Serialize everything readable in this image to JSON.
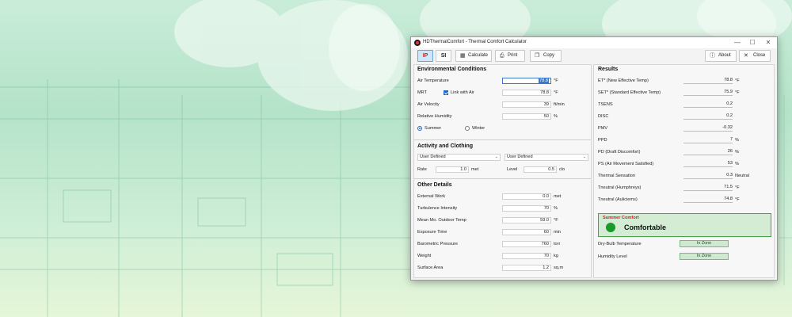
{
  "window": {
    "title": "HDThermalComfort - Thermal Comfort Calculator",
    "controls": [
      "—",
      "☐",
      "✕"
    ]
  },
  "toolbar": {
    "ip_label": "IP",
    "si_label": "SI",
    "calculate_label": "Calculate",
    "print_label": "Print",
    "copy_label": "Copy",
    "about_label": "About",
    "close_label": "Close",
    "active_unit": "IP"
  },
  "environmental": {
    "title": "Environmental Conditions",
    "air_temp": {
      "label": "Air Temperature",
      "value": "78.8",
      "unit": "°F"
    },
    "mrt": {
      "label": "MRT",
      "link_label": "Link with Air",
      "linked": true,
      "value": "78.8",
      "unit": "°F"
    },
    "air_velocity": {
      "label": "Air Velocity",
      "value": "39",
      "unit": "ft/min"
    },
    "humidity": {
      "label": "Relative Humidity",
      "value": "50",
      "unit": "%"
    },
    "season": {
      "summer_label": "Summer",
      "winter_label": "Winter",
      "selected": "Summer"
    }
  },
  "activity": {
    "title": "Activity and Clothing",
    "activity_select": "User Defined",
    "clothing_select": "User Defined",
    "rate": {
      "label": "Rate",
      "value": "1.0",
      "unit": "met"
    },
    "level": {
      "label": "Level",
      "value": "0.5",
      "unit": "clo"
    }
  },
  "other": {
    "title": "Other Details",
    "rows": [
      {
        "label": "External Work",
        "value": "0.0",
        "unit": "met"
      },
      {
        "label": "Turbulence Intensity",
        "value": "70",
        "unit": "%"
      },
      {
        "label": "Mean Mo. Outdoor Temp",
        "value": "59.0",
        "unit": "°F"
      },
      {
        "label": "Exposure Time",
        "value": "60",
        "unit": "min"
      },
      {
        "label": "Barometric Pressure",
        "value": "760",
        "unit": "torr"
      },
      {
        "label": "Weight",
        "value": "70",
        "unit": "kg"
      },
      {
        "label": "Surface Area",
        "value": "1.2",
        "unit": "sq.m"
      }
    ]
  },
  "results": {
    "title": "Results",
    "rows": [
      {
        "label": "ET* (New Effective Temp)",
        "value": "78.8",
        "unit": "°F"
      },
      {
        "label": "SET* (Standard Effective Temp)",
        "value": "75.9",
        "unit": "°F"
      },
      {
        "label": "TSENS",
        "value": "0.2",
        "unit": ""
      },
      {
        "label": "DISC",
        "value": "0.2",
        "unit": ""
      },
      {
        "label": "PMV",
        "value": "-0.32",
        "unit": ""
      },
      {
        "label": "PPD",
        "value": "7",
        "unit": "%"
      },
      {
        "label": "PD (Draft Discomfort)",
        "value": "26",
        "unit": "%"
      },
      {
        "label": "PS (Air Movement Satisfied)",
        "value": "53",
        "unit": "%"
      },
      {
        "label": "Thermal Sensation",
        "value": "0.3",
        "unit": "Neutral"
      },
      {
        "label": "Tneutral (Humphreys)",
        "value": "71.5",
        "unit": "°F"
      },
      {
        "label": "Tneutral (Auliciems)",
        "value": "74.8",
        "unit": "°F"
      }
    ],
    "comfort": {
      "title": "Summer Comfort",
      "status": "Comfortable",
      "color": "#1a9a2a"
    },
    "zones": [
      {
        "label": "Dry-Bulb Temperature",
        "status": "In Zone"
      },
      {
        "label": "Humidity Level",
        "status": "In Zone"
      }
    ]
  }
}
